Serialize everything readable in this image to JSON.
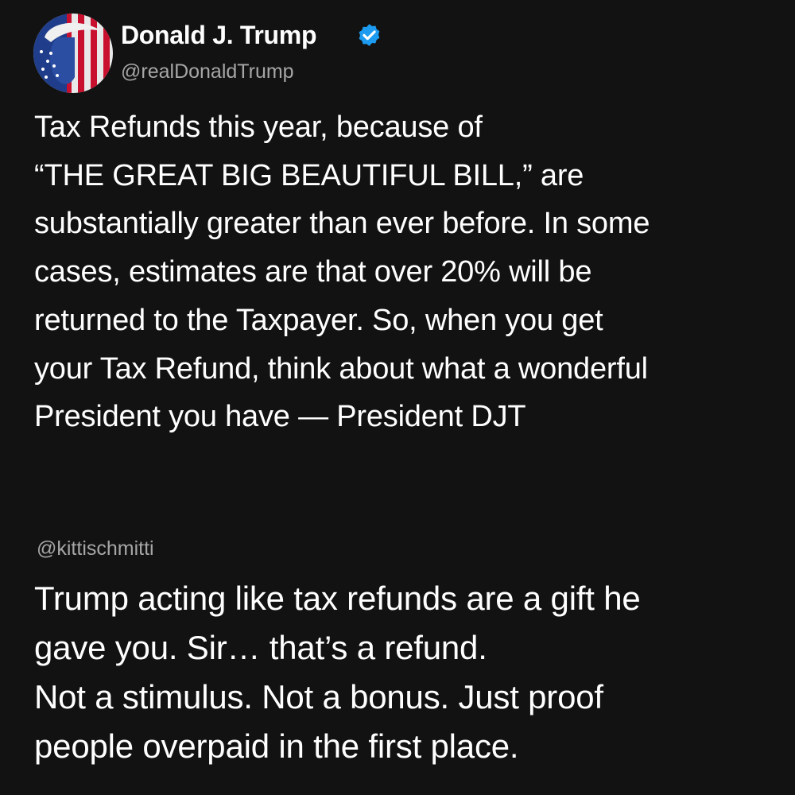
{
  "post": {
    "author": {
      "name": "Donald J. Trump",
      "handle": "@realDonaldTrump",
      "verified_color": "#1d9bf0"
    },
    "text": "Tax Refunds this year, because of\n“THE GREAT BIG BEAUTIFUL BILL,” are\nsubstantially greater than ever before. In some\ncases, estimates are that over 20% will be\nreturned to the Taxpayer. So, when you get\nyour Tax Refund, think about what a wonderful\nPresident you have —  President DJT"
  },
  "reply": {
    "handle": "@kittischmitti",
    "text": "Trump acting like tax refunds are a gift he\ngave you. Sir… that’s a refund.\nNot a stimulus. Not a bonus. Just proof\npeople overpaid in the first place."
  },
  "colors": {
    "background": "#121212",
    "text": "#ffffff",
    "secondary_text": "#a6a6a6"
  }
}
